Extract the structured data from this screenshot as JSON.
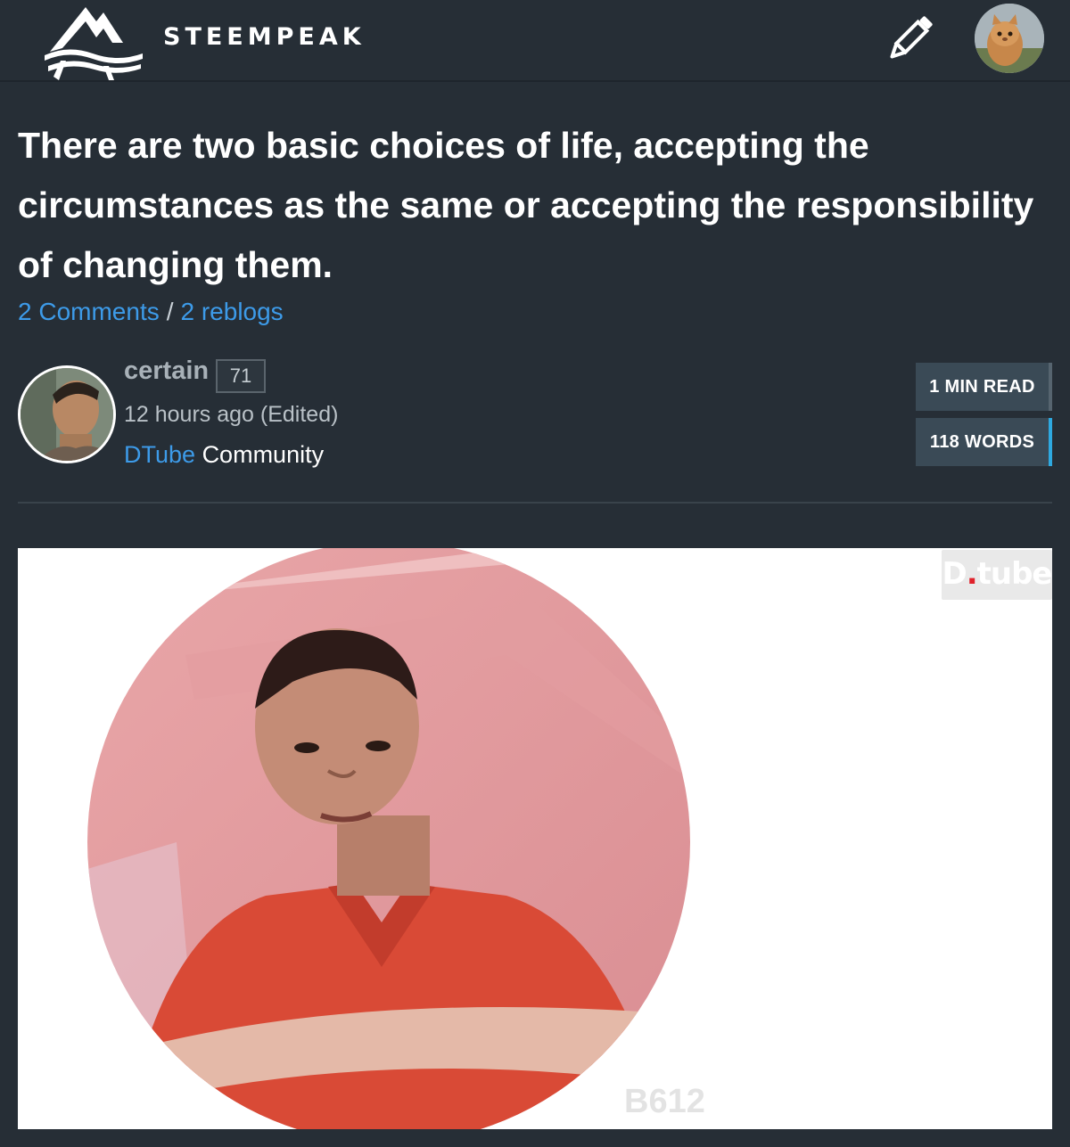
{
  "header": {
    "brand": "STEEMPEAK",
    "write_icon": "pencil-icon",
    "user_avatar": "user-avatar-kitten"
  },
  "post": {
    "title": "There are two basic choices of life, accepting the circumstances as the same or accepting the responsibility of changing them.",
    "comments_label": "2 Comments",
    "separator": "/",
    "reblogs_label": "2 reblogs"
  },
  "author": {
    "name": "certain",
    "reputation": "71",
    "time": "12 hours ago (Edited)",
    "community_tag": "DTube",
    "community_label": "Community"
  },
  "stats": {
    "read_time": "1 MIN READ",
    "word_count": "118 WORDS"
  },
  "video": {
    "badge_prefix": "D",
    "badge_dot": ".",
    "badge_text": "tube",
    "watermark": "B612"
  },
  "colors": {
    "background": "#262e36",
    "link": "#3d9be9",
    "chip": "#3a4a56",
    "chip_accent": "#2ea9e0"
  }
}
